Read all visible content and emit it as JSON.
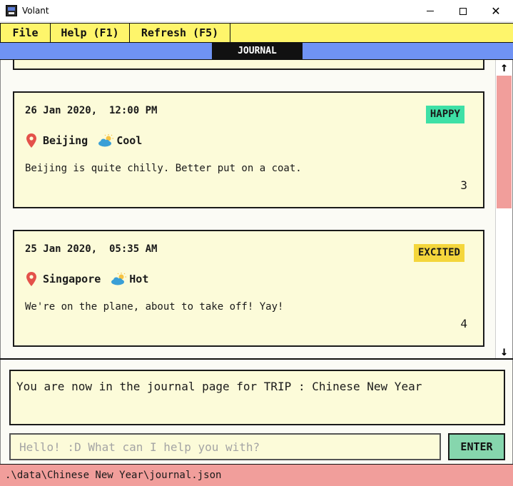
{
  "window": {
    "title": "Volant",
    "icons": {
      "app": "volant-app-icon",
      "minimize": "minimize-icon",
      "maximize": "maximize-icon",
      "close": "close-icon"
    }
  },
  "menu": {
    "file": "File",
    "help": "Help (F1)",
    "refresh": "Refresh (F5)"
  },
  "tab": {
    "label": "JOURNAL"
  },
  "entries": [
    {
      "date": "26 Jan 2020,  12:00 PM",
      "mood": "HAPPY",
      "location": "Beijing",
      "weather": "Cool",
      "text": "Beijing is quite chilly. Better put on a coat.",
      "count": "3"
    },
    {
      "date": "25 Jan 2020,  05:35 AM",
      "mood": "EXCITED",
      "location": "Singapore",
      "weather": "Hot",
      "text": "We're on the plane, about to take off! Yay!",
      "count": "4"
    }
  ],
  "result": {
    "text": "You are now in the journal page for TRIP : Chinese New Year"
  },
  "command": {
    "placeholder": "Hello! :D What can I help you with?",
    "value": ""
  },
  "enter_button": "ENTER",
  "status": {
    "path": ".\\data\\Chinese New Year\\journal.json"
  },
  "icons": {
    "location": "location-pin-icon",
    "weather": "partly-cloudy-icon",
    "scroll_up": "arrow-up-icon",
    "scroll_down": "arrow-down-icon"
  },
  "colors": {
    "menubar": "#fef56b",
    "tabbar": "#6f93f4",
    "card": "#fcfbd9",
    "mood_happy": "#3ee0a6",
    "mood_excited": "#f4d63c",
    "scroll_thumb": "#f19e9b",
    "enter_button": "#86d6ad",
    "statusbar": "#f19e9b",
    "pin": "#e4514a",
    "cloud": "#3a9fd6",
    "sun": "#f6c343"
  }
}
